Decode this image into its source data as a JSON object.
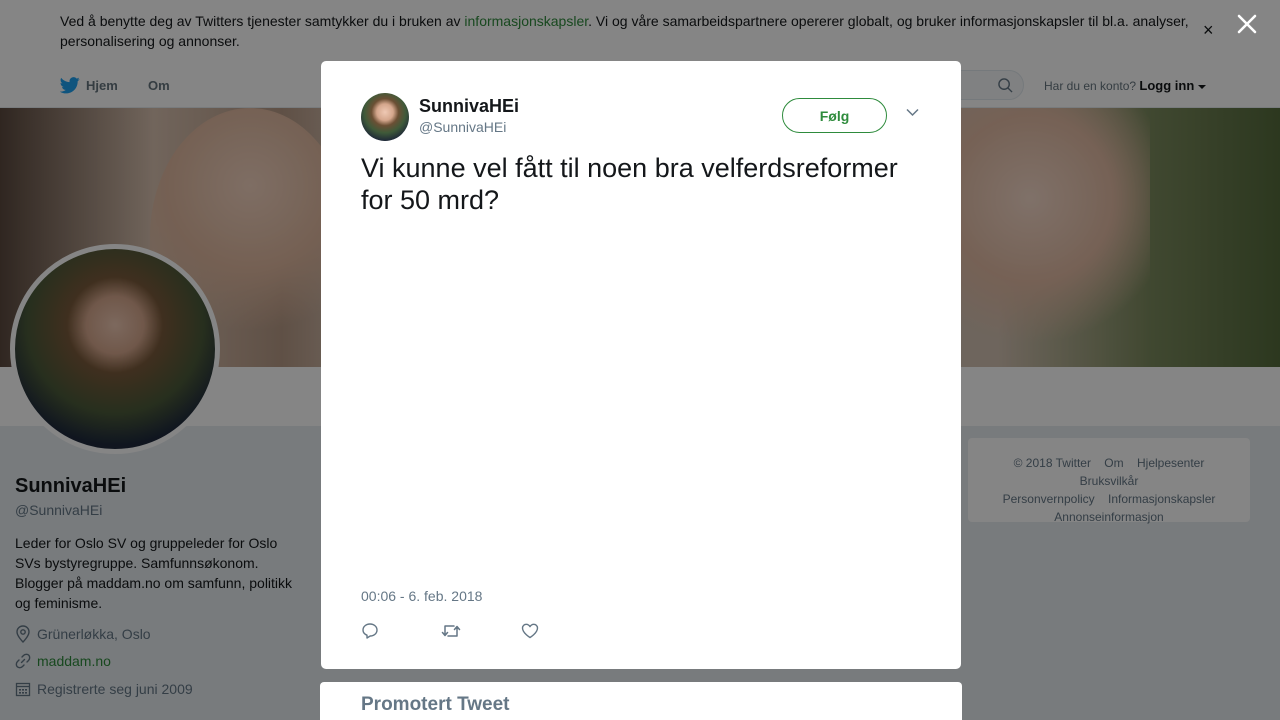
{
  "cookie": {
    "text_before": "Ved å benytte deg av Twitters tjenester samtykker du i bruken av ",
    "link": "informasjonskapsler",
    "text_after": ". Vi og våre samarbeidspartnere opererer globalt, og bruker informasjonskapsler til bl.a. analyser, personalisering og annonser.",
    "close": "×"
  },
  "nav": {
    "home": "Hjem",
    "about": "Om",
    "login_prompt": "Har du en konto?",
    "login": "Logg inn"
  },
  "profile": {
    "name": "SunnivaHEi",
    "handle": "@SunnivaHEi",
    "bio": "Leder for Oslo SV og gruppeleder for Oslo SVs bystyregruppe. Samfunnsøkonom. Blogger på maddam.no om samfunn, politikk og feminisme.",
    "location": "Grünerløkka, Oslo",
    "website": "maddam.no",
    "joined": "Registrerte seg juni 2009"
  },
  "footer": {
    "row1": [
      "© 2018 Twitter",
      "Om",
      "Hjelpesenter",
      "Bruksvilkår"
    ],
    "row2": [
      "Personvernpolicy",
      "Informasjonskapsler"
    ],
    "row3": [
      "Annonseinformasjon"
    ]
  },
  "promo": {
    "title": "Promotert Tweet"
  },
  "tweet": {
    "name": "SunnivaHEi",
    "handle": "@SunnivaHEi",
    "follow": "Følg",
    "text": "Vi kunne vel fått til noen bra velferdsreformer for 50 mrd?",
    "timestamp": "00:06 - 6. feb. 2018"
  },
  "colors": {
    "accent": "#2e8b3c",
    "secondary_text": "#657786"
  }
}
